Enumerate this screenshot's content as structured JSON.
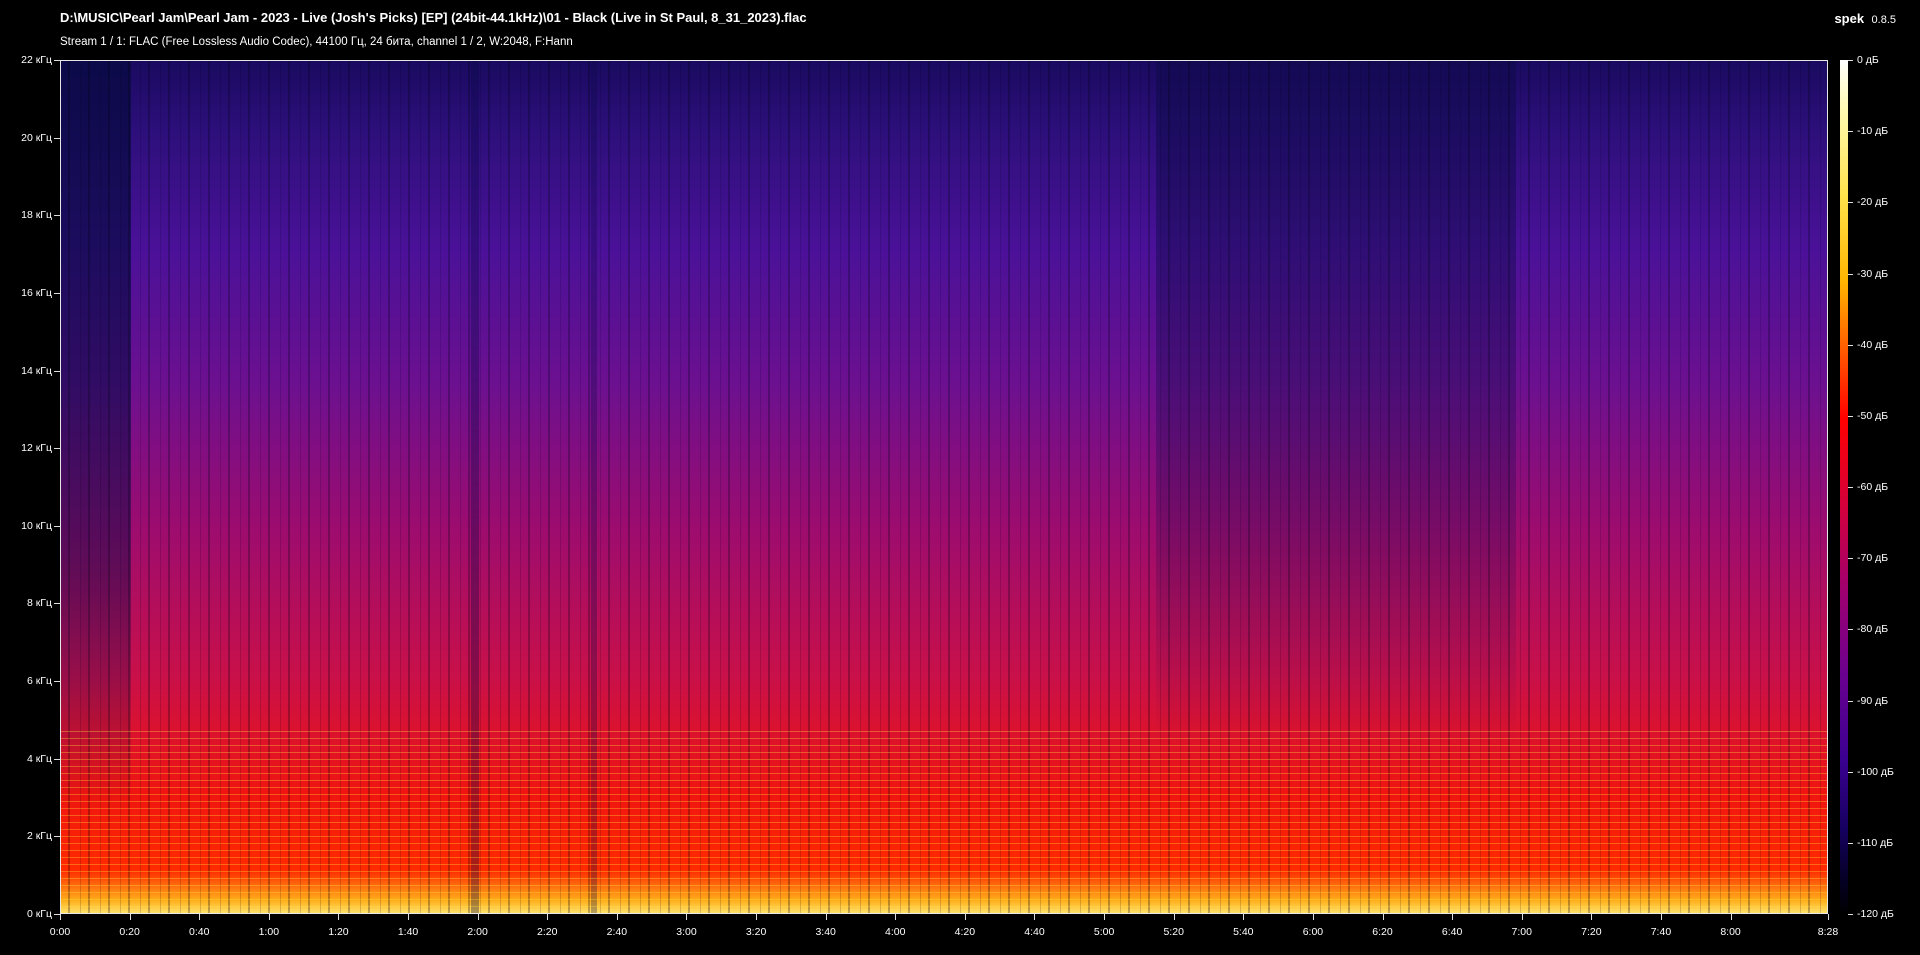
{
  "window": {
    "title": "D:\\MUSIC\\Pearl Jam\\Pearl Jam - 2023 - Live (Josh's Picks) [EP] (24bit-44.1kHz)\\01 - Black (Live in St Paul, 8_31_2023).flac",
    "stream_info": "Stream 1 / 1: FLAC (Free Lossless Audio Codec), 44100 Гц, 24 бита, channel 1 / 2, W:2048, F:Hann",
    "app_name": "spek",
    "app_version": "0.8.5"
  },
  "spectrogram": {
    "freq_axis": [
      "0 кГц",
      "2 кГц",
      "4 кГц",
      "6 кГц",
      "8 кГц",
      "10 кГц",
      "12 кГц",
      "14 кГц",
      "16 кГц",
      "18 кГц",
      "20 кГц",
      "22 кГц"
    ],
    "freq_max_khz": 22,
    "time_axis": [
      "0:00",
      "0:20",
      "0:40",
      "1:00",
      "1:20",
      "1:40",
      "2:00",
      "2:20",
      "2:40",
      "3:00",
      "3:20",
      "3:40",
      "4:00",
      "4:20",
      "4:40",
      "5:00",
      "5:20",
      "5:40",
      "6:00",
      "6:20",
      "6:40",
      "7:00",
      "7:20",
      "7:40",
      "8:00",
      "8:28"
    ],
    "time_tick_seconds": [
      0,
      20,
      40,
      60,
      80,
      100,
      120,
      140,
      160,
      180,
      200,
      220,
      240,
      260,
      280,
      300,
      320,
      340,
      360,
      380,
      400,
      420,
      440,
      460,
      480,
      508
    ],
    "duration_seconds": 508,
    "db_axis": [
      "0 дБ",
      "-10 дБ",
      "-20 дБ",
      "-30 дБ",
      "-40 дБ",
      "-50 дБ",
      "-60 дБ",
      "-70 дБ",
      "-80 дБ",
      "-90 дБ",
      "-100 дБ",
      "-110 дБ",
      "-120 дБ"
    ],
    "db_range": [
      0,
      -120
    ]
  }
}
